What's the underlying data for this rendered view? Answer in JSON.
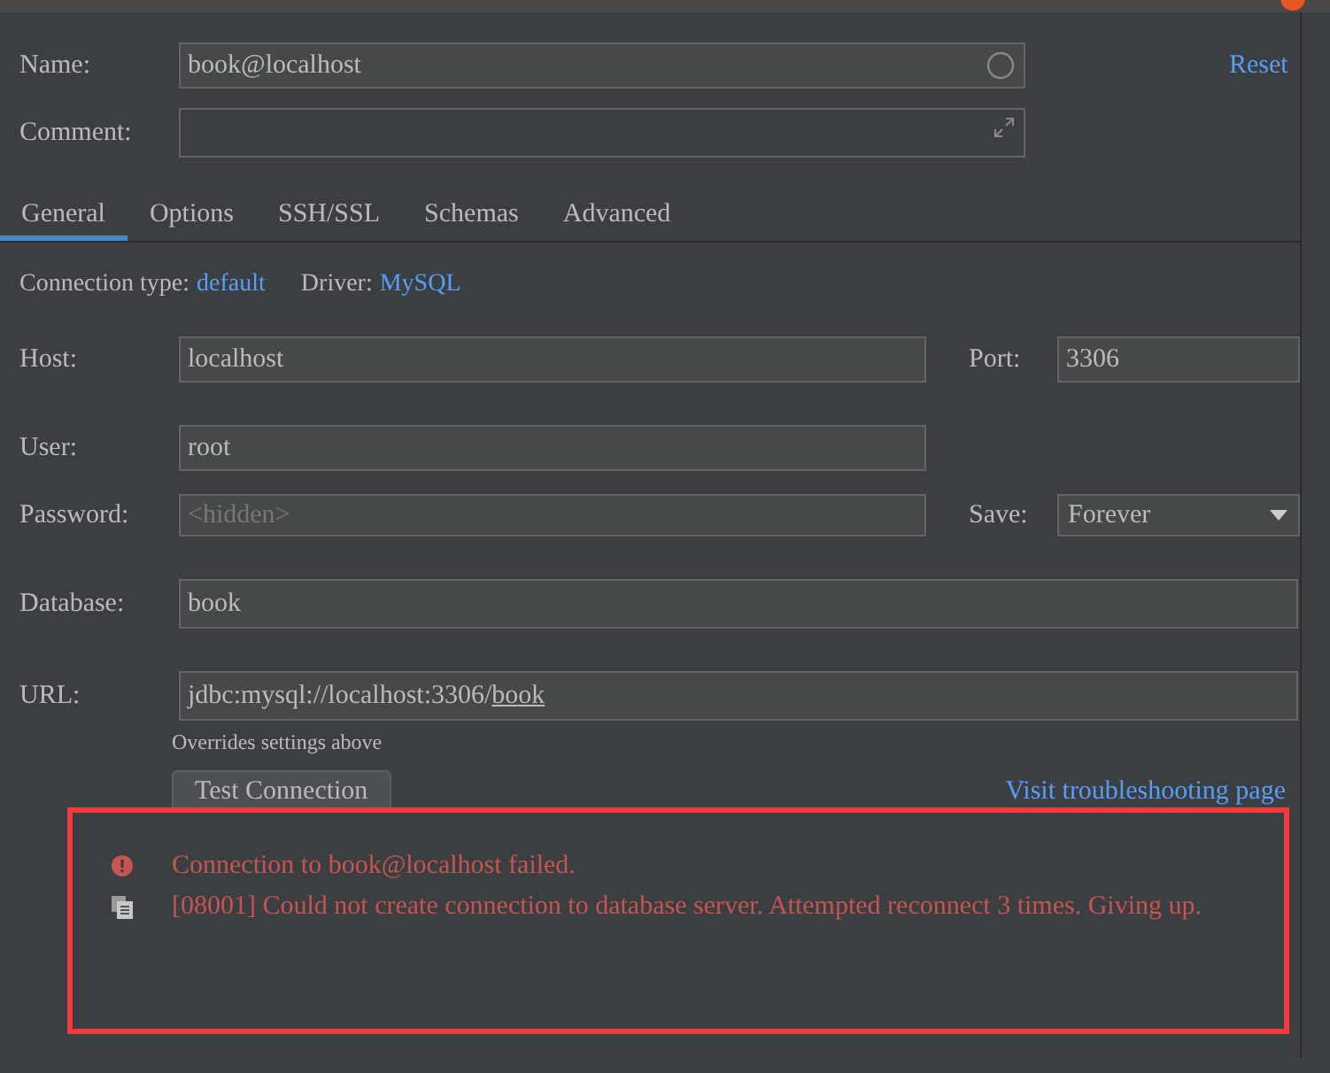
{
  "name": {
    "label": "Name:",
    "value": "book@localhost"
  },
  "reset": "Reset",
  "comment": {
    "label": "Comment:"
  },
  "tabs": [
    {
      "label": "General",
      "selected": true
    },
    {
      "label": "Options",
      "selected": false
    },
    {
      "label": "SSH/SSL",
      "selected": false
    },
    {
      "label": "Schemas",
      "selected": false
    },
    {
      "label": "Advanced",
      "selected": false
    }
  ],
  "connection_type": {
    "label": "Connection type:",
    "value": "default"
  },
  "driver": {
    "label": "Driver:",
    "value": "MySQL"
  },
  "host": {
    "label": "Host:",
    "value": "localhost"
  },
  "port": {
    "label": "Port:",
    "value": "3306"
  },
  "user": {
    "label": "User:",
    "value": "root"
  },
  "password": {
    "label": "Password:",
    "placeholder": "<hidden>"
  },
  "save": {
    "label": "Save:",
    "value": "Forever"
  },
  "database": {
    "label": "Database:",
    "value": "book"
  },
  "url": {
    "label": "URL:",
    "prefix": "jdbc:mysql://localhost:3306/",
    "link": "book",
    "hint": "Overrides settings above"
  },
  "test_button": "Test Connection",
  "troubleshoot_link": "Visit troubleshooting page",
  "error": {
    "title": "Connection to book@localhost failed.",
    "detail": "[08001] Could not create connection to database server. Attempted reconnect 3 times. Giving up."
  },
  "highlighted": true
}
